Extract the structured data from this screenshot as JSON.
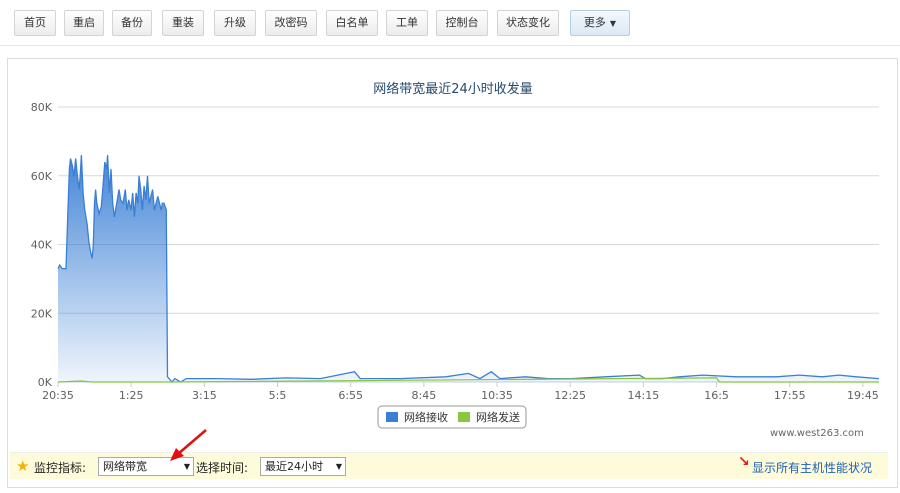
{
  "toolbar": {
    "buttons": [
      "首页",
      "重启",
      "备份",
      "重装",
      "升级",
      "改密码",
      "白名单",
      "工单",
      "控制台",
      "状态变化"
    ],
    "more_label": "更多"
  },
  "chart_data": {
    "type": "area",
    "title": "网络带宽最近24小时收发量",
    "xlabel": "",
    "ylabel": "",
    "ylim": [
      0,
      80000
    ],
    "y_ticks": [
      "0K",
      "20K",
      "40K",
      "60K",
      "80K"
    ],
    "x_ticks": [
      "20:35",
      "1:25",
      "3:15",
      "5:5",
      "6:55",
      "8:45",
      "10:35",
      "12:25",
      "14:15",
      "16:5",
      "17:55",
      "19:45"
    ],
    "x_range_minutes": [
      0,
      1440
    ],
    "legend": "bottom-center",
    "grid": true,
    "series": [
      {
        "name": "网络接收",
        "color": "#3a7fd5",
        "points": [
          [
            0,
            33000
          ],
          [
            3,
            34000
          ],
          [
            7,
            33000
          ],
          [
            14,
            33000
          ],
          [
            17,
            48000
          ],
          [
            20,
            62000
          ],
          [
            22,
            65000
          ],
          [
            25,
            63000
          ],
          [
            28,
            60000
          ],
          [
            31,
            65000
          ],
          [
            34,
            60000
          ],
          [
            37,
            56000
          ],
          [
            39,
            60000
          ],
          [
            41,
            66000
          ],
          [
            44,
            55000
          ],
          [
            47,
            50000
          ],
          [
            51,
            46000
          ],
          [
            54,
            41000
          ],
          [
            57,
            38000
          ],
          [
            60,
            36000
          ],
          [
            62,
            40000
          ],
          [
            64,
            52000
          ],
          [
            66,
            56000
          ],
          [
            68,
            52000
          ],
          [
            72,
            49000
          ],
          [
            76,
            51000
          ],
          [
            79,
            57000
          ],
          [
            82,
            64000
          ],
          [
            85,
            62000
          ],
          [
            87,
            66000
          ],
          [
            90,
            55000
          ],
          [
            93,
            62000
          ],
          [
            96,
            52000
          ],
          [
            99,
            48000
          ],
          [
            103,
            52000
          ],
          [
            107,
            56000
          ],
          [
            110,
            53000
          ],
          [
            114,
            52000
          ],
          [
            118,
            56000
          ],
          [
            121,
            50000
          ],
          [
            124,
            53000
          ],
          [
            128,
            50000
          ],
          [
            131,
            55000
          ],
          [
            134,
            48000
          ],
          [
            137,
            55000
          ],
          [
            140,
            52000
          ],
          [
            142,
            60000
          ],
          [
            145,
            56000
          ],
          [
            148,
            50000
          ],
          [
            151,
            57000
          ],
          [
            154,
            53000
          ],
          [
            157,
            60000
          ],
          [
            160,
            52000
          ],
          [
            163,
            54000
          ],
          [
            166,
            56000
          ],
          [
            169,
            50000
          ],
          [
            172,
            52000
          ],
          [
            175,
            54000
          ],
          [
            178,
            52000
          ],
          [
            181,
            50000
          ],
          [
            183,
            52000
          ],
          [
            186,
            52000
          ],
          [
            190,
            50000
          ],
          [
            192,
            1500
          ],
          [
            200,
            0
          ],
          [
            205,
            1000
          ],
          [
            215,
            0
          ],
          [
            225,
            1000
          ],
          [
            240,
            1000
          ],
          [
            280,
            1000
          ],
          [
            340,
            800
          ],
          [
            400,
            1200
          ],
          [
            460,
            1000
          ],
          [
            520,
            3000
          ],
          [
            530,
            1000
          ],
          [
            600,
            1000
          ],
          [
            680,
            1500
          ],
          [
            720,
            2500
          ],
          [
            740,
            1000
          ],
          [
            760,
            3000
          ],
          [
            775,
            1000
          ],
          [
            820,
            1500
          ],
          [
            860,
            1000
          ],
          [
            900,
            1000
          ],
          [
            960,
            1500
          ],
          [
            1020,
            2000
          ],
          [
            1030,
            1000
          ],
          [
            1060,
            1000
          ],
          [
            1090,
            1500
          ],
          [
            1130,
            2000
          ],
          [
            1190,
            1500
          ],
          [
            1260,
            1500
          ],
          [
            1300,
            2000
          ],
          [
            1340,
            1500
          ],
          [
            1370,
            2000
          ],
          [
            1400,
            1500
          ],
          [
            1440,
            1000
          ]
        ]
      },
      {
        "name": "网络发送",
        "color": "#8ac53e",
        "points": [
          [
            0,
            0
          ],
          [
            40,
            300
          ],
          [
            60,
            0
          ],
          [
            200,
            0
          ],
          [
            1155,
            1200
          ],
          [
            1160,
            0
          ],
          [
            1440,
            0
          ]
        ]
      }
    ]
  },
  "watermark": "www.west263.com",
  "bottom": {
    "monitor_label": "监控指标:",
    "monitor_value": "网络带宽",
    "time_label": "选择时间:",
    "time_value": "最近24小时",
    "show_all_label": "显示所有主机性能状况"
  }
}
